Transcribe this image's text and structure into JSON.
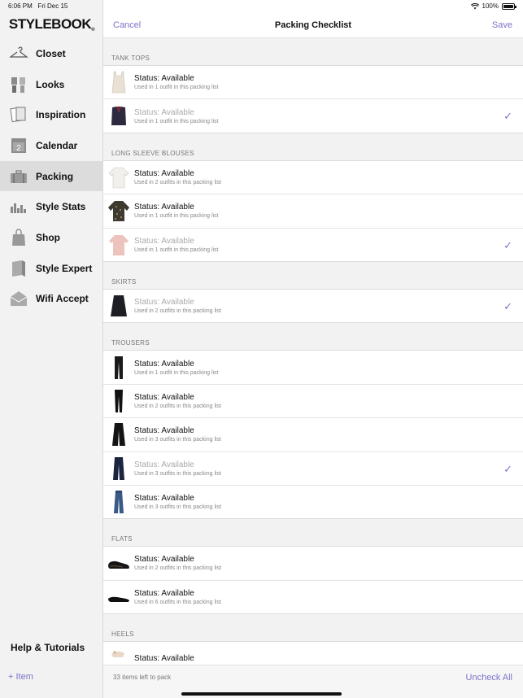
{
  "status": {
    "time": "6:06 PM",
    "date": "Fri Dec 15",
    "battery": "100%"
  },
  "sidebar": {
    "logo": "STYLEBOOK",
    "items": [
      {
        "label": "Closet",
        "icon": "hanger-icon"
      },
      {
        "label": "Looks",
        "icon": "looks-icon"
      },
      {
        "label": "Inspiration",
        "icon": "inspiration-icon"
      },
      {
        "label": "Calendar",
        "icon": "calendar-icon"
      },
      {
        "label": "Packing",
        "icon": "suitcase-icon"
      },
      {
        "label": "Style Stats",
        "icon": "bar-chart-icon"
      },
      {
        "label": "Shop",
        "icon": "shopping-bag-icon"
      },
      {
        "label": "Style Expert",
        "icon": "style-expert-icon"
      },
      {
        "label": "Wifi Accept",
        "icon": "envelope-icon"
      }
    ],
    "help": "Help & Tutorials",
    "add_item": "+ Item"
  },
  "topbar": {
    "cancel": "Cancel",
    "title": "Packing Checklist",
    "save": "Save"
  },
  "sections": [
    {
      "header": "TANK TOPS",
      "rows": [
        {
          "status": "Status: Available",
          "usage": "Used in 1 outfit in this packing list",
          "checked": false
        },
        {
          "status": "Status: Available",
          "usage": "Used in 1 outfit in this packing list",
          "checked": true
        }
      ]
    },
    {
      "header": "LONG SLEEVE BLOUSES",
      "rows": [
        {
          "status": "Status: Available",
          "usage": "Used in 2 outfits in this packing list",
          "checked": false
        },
        {
          "status": "Status: Available",
          "usage": "Used in 1 outfit in this packing list",
          "checked": false
        },
        {
          "status": "Status: Available",
          "usage": "Used in 1 outfit in this packing list",
          "checked": true
        }
      ]
    },
    {
      "header": "SKIRTS",
      "rows": [
        {
          "status": "Status: Available",
          "usage": "Used in 2 outfits in this packing list",
          "checked": true
        }
      ]
    },
    {
      "header": "TROUSERS",
      "rows": [
        {
          "status": "Status: Available",
          "usage": "Used in 1 outfit in this packing list",
          "checked": false
        },
        {
          "status": "Status: Available",
          "usage": "Used in 2 outfits in this packing list",
          "checked": false
        },
        {
          "status": "Status: Available",
          "usage": "Used in 3 outfits in this packing list",
          "checked": false
        },
        {
          "status": "Status: Available",
          "usage": "Used in 3 outfits in this packing list",
          "checked": true
        },
        {
          "status": "Status: Available",
          "usage": "Used in 3 outfits in this packing list",
          "checked": false
        }
      ]
    },
    {
      "header": "FLATS",
      "rows": [
        {
          "status": "Status: Available",
          "usage": "Used in 2 outfits in this packing list",
          "checked": false
        },
        {
          "status": "Status: Available",
          "usage": "Used in 6 outfits in this packing list",
          "checked": false
        }
      ]
    },
    {
      "header": "HEELS",
      "rows": [
        {
          "status": "Status: Available",
          "usage": "",
          "checked": false
        }
      ]
    }
  ],
  "bottombar": {
    "items_left": "33 items left to pack",
    "uncheck_all": "Uncheck All"
  },
  "colors": {
    "accent": "#7b73c9",
    "sidebar_bg": "#f2f2f2",
    "active_bg": "#dcdcdc"
  }
}
